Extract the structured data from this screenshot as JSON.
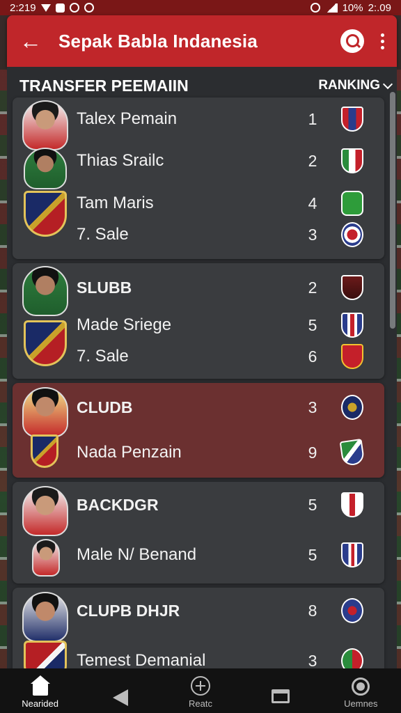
{
  "status": {
    "time": "2:219",
    "battery": "10%",
    "clock": "2:.09"
  },
  "appbar": {
    "title": "Sepak Babla Indanesia",
    "back_icon": "arrow-left-icon",
    "search_icon": "search-icon",
    "menu_icon": "more-vertical-icon"
  },
  "list": {
    "title": "TRANSFER PEEMAIIN",
    "sort_label": "RANKING"
  },
  "cards": [
    {
      "rows": [
        {
          "name": "Talex Pemain",
          "num": "1"
        },
        {
          "name": "Thias Srailc",
          "num": "2"
        },
        {
          "name": "Tam Maris",
          "num": "4"
        },
        {
          "name": "7. Sale",
          "num": "3"
        }
      ]
    },
    {
      "rows": [
        {
          "name": "SLUBB",
          "num": "2"
        },
        {
          "name": "Made Sriege",
          "num": "5"
        },
        {
          "name": "7. Sale",
          "num": "6"
        }
      ]
    },
    {
      "rows": [
        {
          "name": "CLUDB",
          "num": "3"
        },
        {
          "name": "Nada Penzain",
          "num": "9"
        }
      ]
    },
    {
      "rows": [
        {
          "name": "BACKDGR",
          "num": "5"
        },
        {
          "name": "Male N/ Benand",
          "num": "5"
        }
      ]
    },
    {
      "rows": [
        {
          "name": "CLUPB DHJR",
          "num": "8"
        },
        {
          "name": "Temest Demanial",
          "num": "3"
        }
      ]
    }
  ],
  "nav": {
    "home": "Nearided",
    "back": "",
    "add": "Reatc",
    "window": "",
    "profile": "Uemnes"
  },
  "colors": {
    "appbar": "#c0262a",
    "highlight_card": "#6b3030",
    "card": "#3a3c3f"
  }
}
